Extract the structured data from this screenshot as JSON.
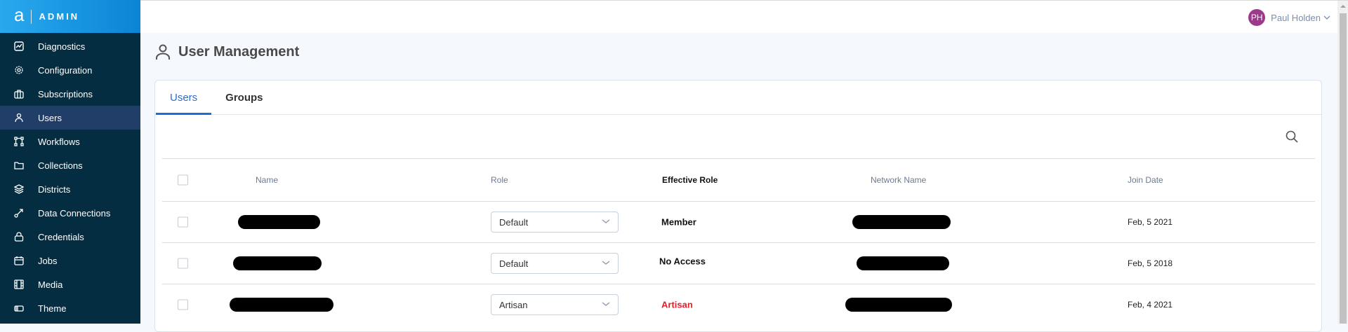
{
  "brand": {
    "logo": "a",
    "title": "ADMIN"
  },
  "sidebar": {
    "items": [
      {
        "label": "Diagnostics",
        "icon": "chart-icon"
      },
      {
        "label": "Configuration",
        "icon": "gear-icon"
      },
      {
        "label": "Subscriptions",
        "icon": "briefcase-icon"
      },
      {
        "label": "Users",
        "icon": "user-icon",
        "active": true
      },
      {
        "label": "Workflows",
        "icon": "workflow-icon"
      },
      {
        "label": "Collections",
        "icon": "folder-icon"
      },
      {
        "label": "Districts",
        "icon": "layers-icon"
      },
      {
        "label": "Data Connections",
        "icon": "connection-icon"
      },
      {
        "label": "Credentials",
        "icon": "lock-icon"
      },
      {
        "label": "Jobs",
        "icon": "calendar-icon"
      },
      {
        "label": "Media",
        "icon": "film-icon"
      },
      {
        "label": "Theme",
        "icon": "theme-icon"
      }
    ]
  },
  "header": {
    "user_initials": "PH",
    "user_name": "Paul Holden",
    "avatar_color": "#9b3a8a"
  },
  "page": {
    "title": "User Management"
  },
  "tabs": [
    {
      "label": "Users"
    },
    {
      "label": "Groups"
    }
  ],
  "table": {
    "columns": [
      "Name",
      "Role",
      "Effective Role",
      "Network Name",
      "Join Date"
    ],
    "rows": [
      {
        "role": "Default",
        "effective_role": "Member",
        "join_date": "Feb, 5 2021"
      },
      {
        "role": "Default",
        "effective_role": "No Access",
        "join_date": "Feb, 5 2018"
      },
      {
        "role": "Artisan",
        "effective_role": "Artisan",
        "join_date": "Feb, 4 2021",
        "effective_color": "#e0202a"
      }
    ]
  }
}
